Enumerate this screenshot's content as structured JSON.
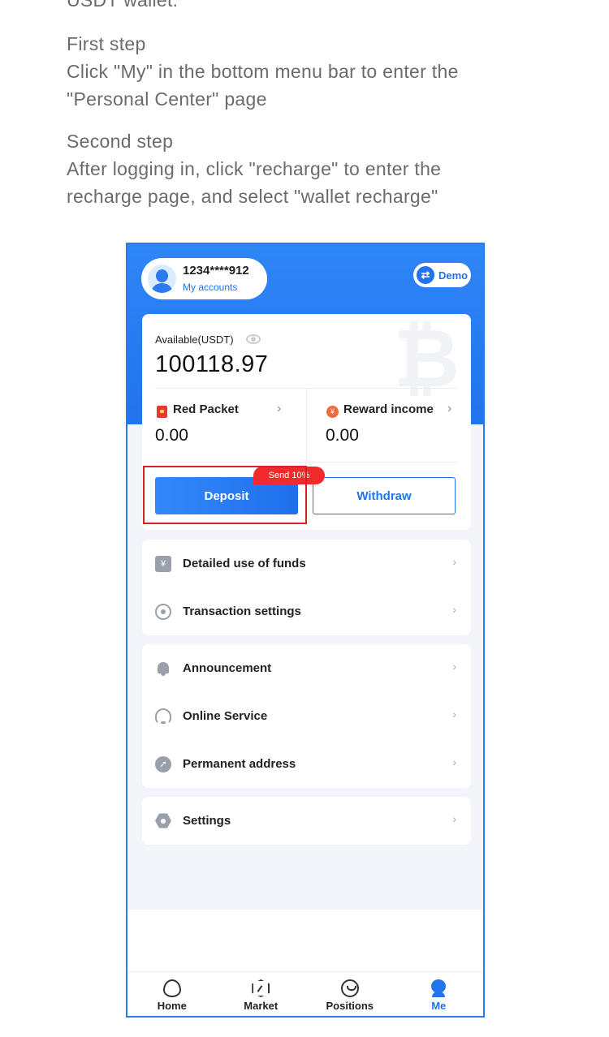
{
  "article": {
    "clipped_line": "USDT wallet.",
    "step1_title": "First step",
    "step1_text": "Click \"My\" in the bottom menu bar to enter the \"Personal Center\" page",
    "step2_title": "Second step",
    "step2_text": "After logging in, click \"recharge\" to enter the recharge page, and select \"wallet recharge\""
  },
  "header": {
    "account_number": "1234****912",
    "account_link": "My accounts",
    "demo_label": "Demo"
  },
  "balance": {
    "label": "Available(USDT)",
    "value": "100118.97"
  },
  "red_packet": {
    "label": "Red Packet",
    "value": "0.00"
  },
  "reward": {
    "label": "Reward income",
    "value": "0.00",
    "icon_glyph": "¥"
  },
  "actions": {
    "deposit_label": "Deposit",
    "withdraw_label": "Withdraw",
    "badge": "Send 10%"
  },
  "menu": {
    "group1": [
      {
        "label": "Detailed use of funds",
        "icon": "funds-icon"
      },
      {
        "label": "Transaction settings",
        "icon": "transaction-settings-icon"
      }
    ],
    "group2": [
      {
        "label": "Announcement",
        "icon": "bell-icon"
      },
      {
        "label": "Online Service",
        "icon": "headset-icon"
      },
      {
        "label": "Permanent address",
        "icon": "address-icon"
      }
    ],
    "group3": [
      {
        "label": "Settings",
        "icon": "settings-icon"
      }
    ],
    "chevron": "›",
    "funds_glyph": "¥",
    "address_glyph": "➚"
  },
  "tabs": [
    {
      "label": "Home",
      "icon": "home-icon"
    },
    {
      "label": "Market",
      "icon": "market-icon"
    },
    {
      "label": "Positions",
      "icon": "positions-icon"
    },
    {
      "label": "Me",
      "icon": "me-icon",
      "active": true
    }
  ],
  "colors": {
    "brand_blue": "#2173ee",
    "highlight_red": "#d61f26",
    "badge_red": "#f12b2b"
  }
}
